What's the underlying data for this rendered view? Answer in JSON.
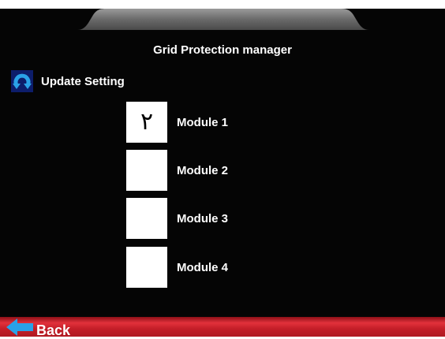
{
  "header": {
    "title": "Grid Protection manager"
  },
  "update": {
    "label": "Update Setting",
    "icon": "refresh-icon"
  },
  "modules": [
    {
      "label": "Module 1",
      "checked": true,
      "mark": "٢"
    },
    {
      "label": "Module 2",
      "checked": false,
      "mark": ""
    },
    {
      "label": "Module 3",
      "checked": false,
      "mark": ""
    },
    {
      "label": "Module 4",
      "checked": false,
      "mark": ""
    }
  ],
  "footer": {
    "back_label": "Back",
    "back_icon": "arrow-left-icon"
  },
  "colors": {
    "background": "#050505",
    "tab": "#6e6e6e",
    "footer": "#d3262f",
    "icon_blue": "#2aa2e8",
    "icon_bg": "#0d1d6b"
  }
}
